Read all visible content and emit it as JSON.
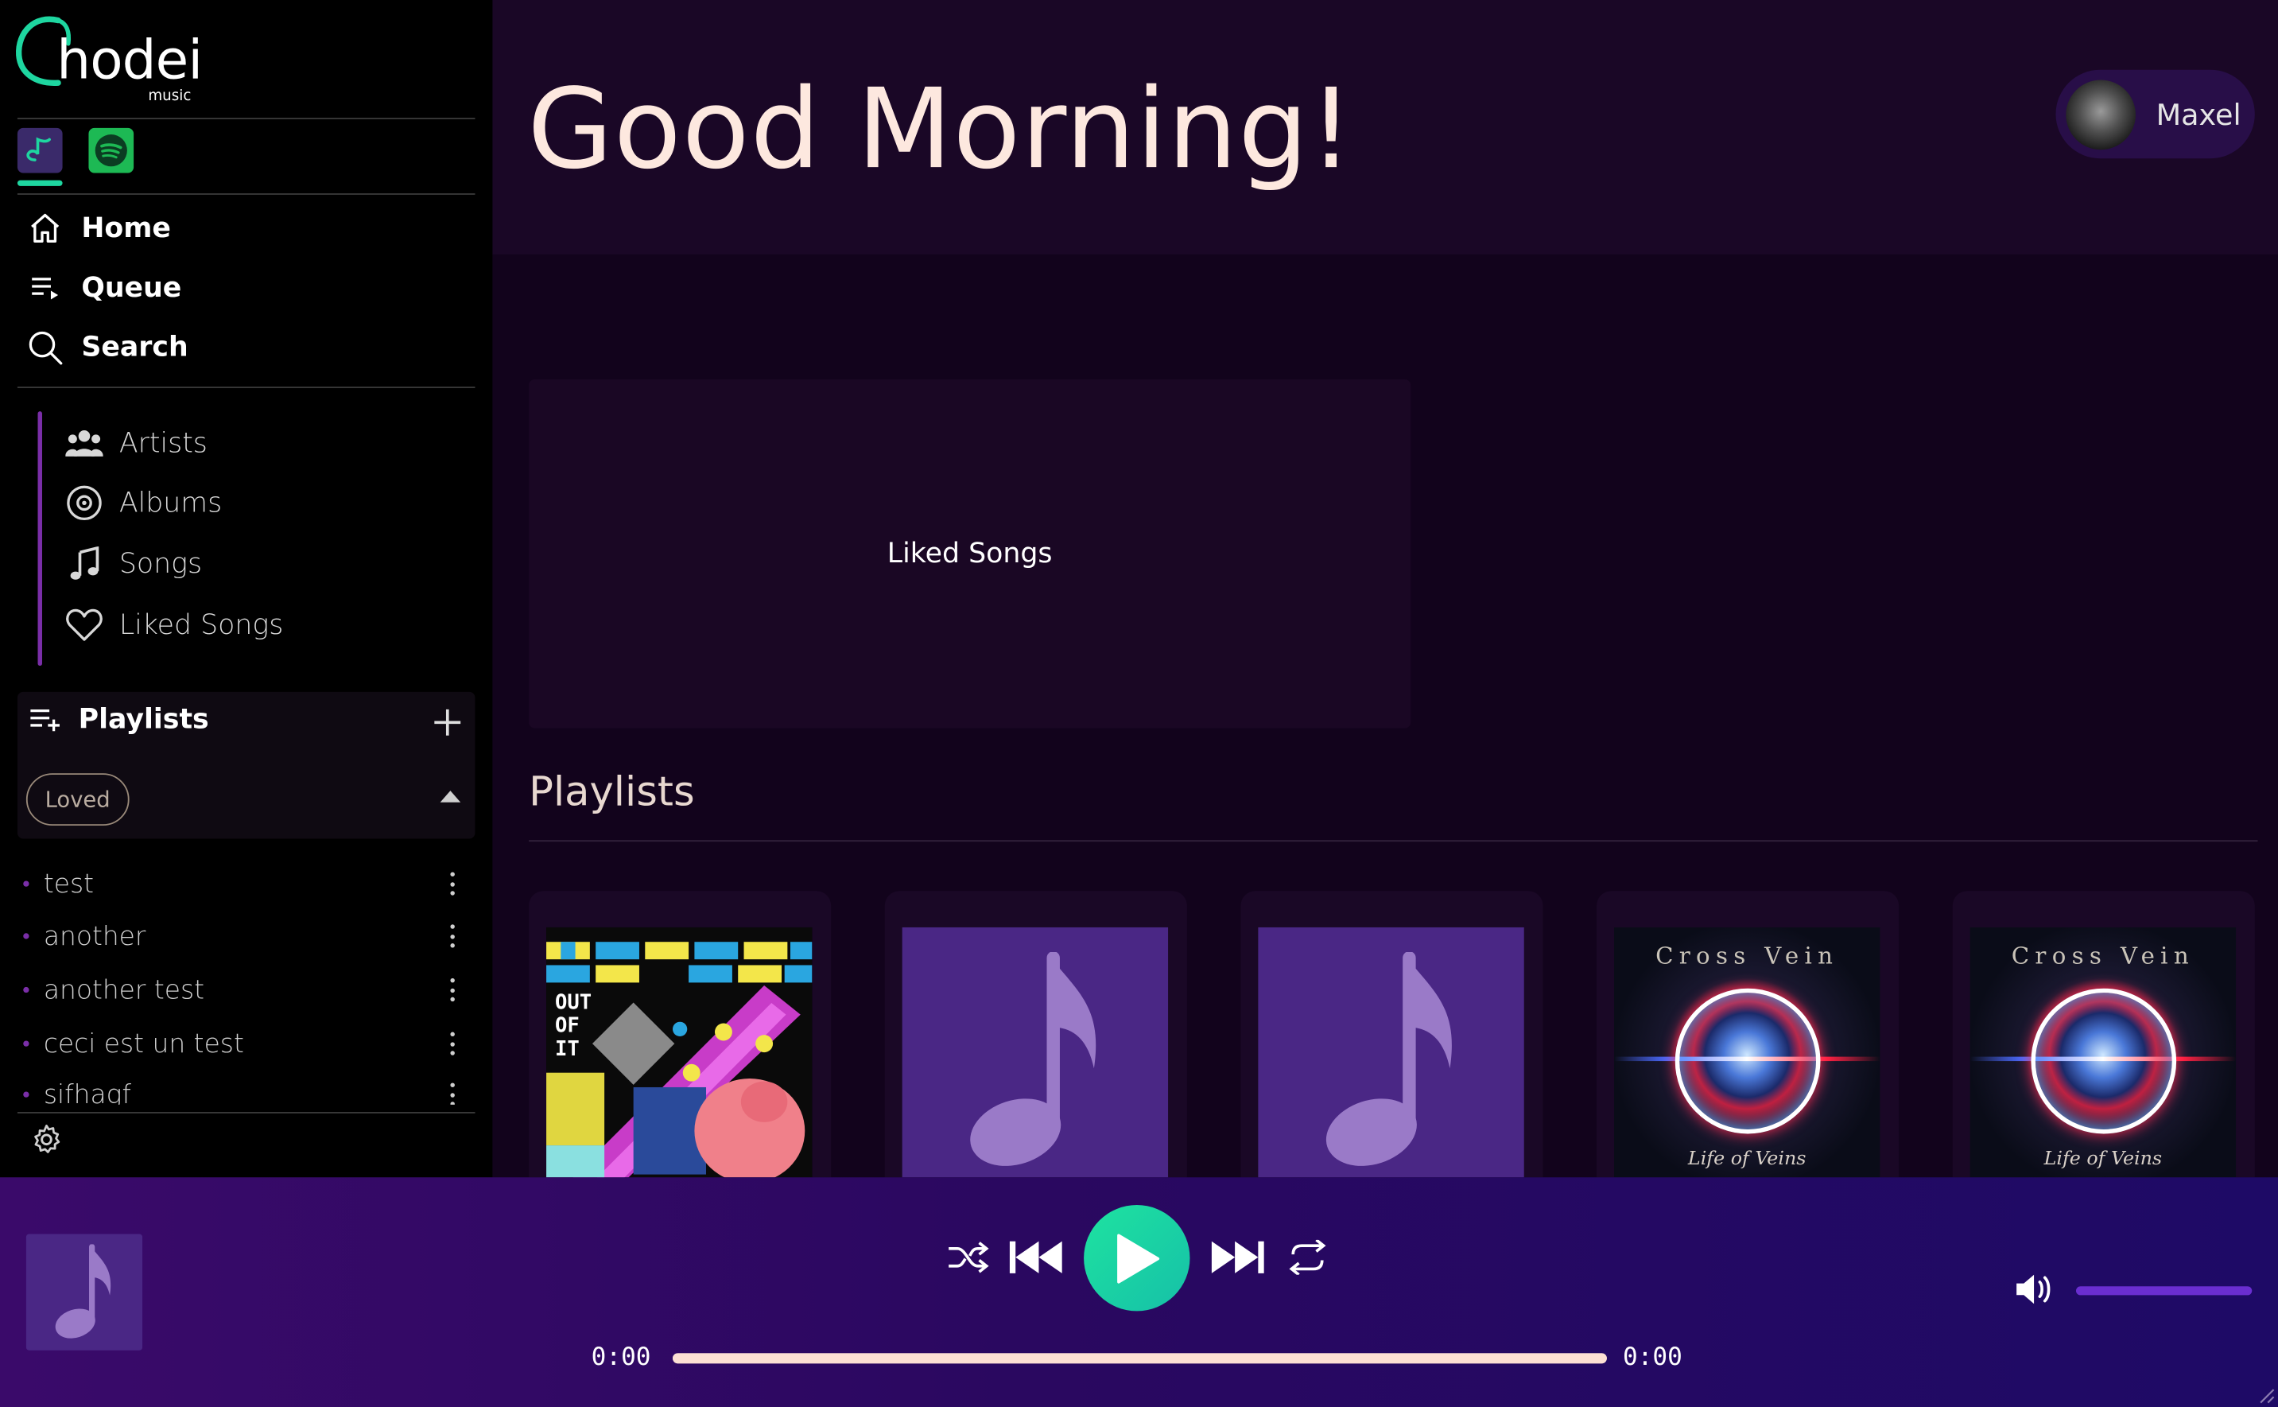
{
  "brand": {
    "name": "hodei",
    "sub": "music",
    "accent": "#1ed6a0",
    "purple": "#7a2ea8"
  },
  "sources": [
    {
      "name": "hodei",
      "icon": "hodei-note-icon",
      "active": true
    },
    {
      "name": "Spotify",
      "icon": "spotify-icon",
      "active": false
    }
  ],
  "nav": [
    {
      "label": "Home",
      "icon": "home-icon"
    },
    {
      "label": "Queue",
      "icon": "queue-icon"
    },
    {
      "label": "Search",
      "icon": "search-icon"
    }
  ],
  "library": [
    {
      "label": "Artists",
      "icon": "artists-icon"
    },
    {
      "label": "Albums",
      "icon": "album-disc-icon"
    },
    {
      "label": "Songs",
      "icon": "music-note-icon"
    },
    {
      "label": "Liked Songs",
      "icon": "heart-icon"
    }
  ],
  "playlists_panel": {
    "title": "Playlists",
    "filter_chip": "Loved",
    "items": [
      "test",
      "another",
      "another test",
      "ceci est un test",
      "sifhagf"
    ]
  },
  "header": {
    "greeting": "Good Morning!",
    "user": "Maxel"
  },
  "liked_card": {
    "label": "Liked Songs"
  },
  "section": {
    "title": "Playlists"
  },
  "playlist_cards": [
    {
      "art": "pixel-art",
      "title": ""
    },
    {
      "art": "music-note",
      "title": ""
    },
    {
      "art": "music-note",
      "title": ""
    },
    {
      "art": "cross-vein",
      "album_title": "Cross Vein",
      "album_sub": "Life of Veins"
    },
    {
      "art": "cross-vein",
      "album_title": "Cross Vein",
      "album_sub": "Life of Veins"
    }
  ],
  "player": {
    "elapsed": "0:00",
    "duration": "0:00",
    "progress": 1.0,
    "volume": 1.0,
    "controls": [
      "shuffle-icon",
      "previous-icon",
      "play-icon",
      "next-icon",
      "repeat-icon"
    ]
  }
}
